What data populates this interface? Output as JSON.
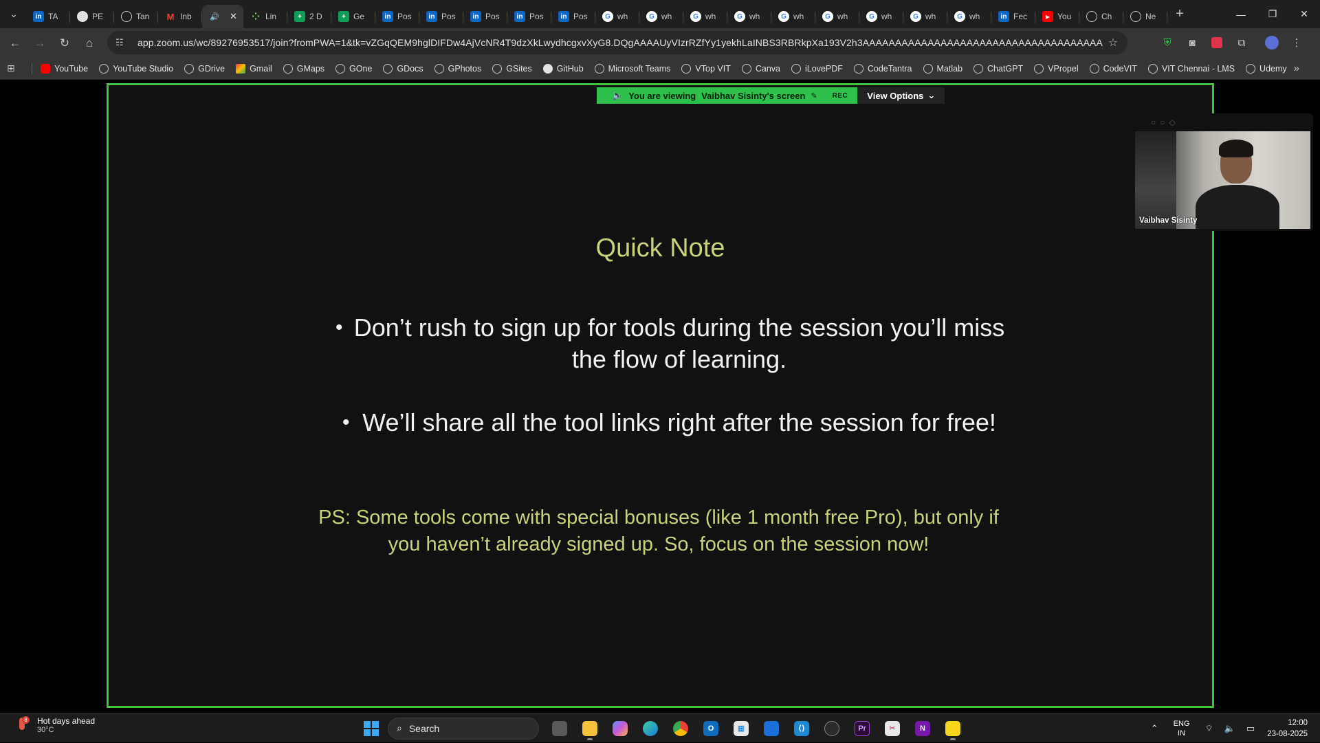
{
  "browser": {
    "tabs": [
      {
        "icon": "linkedin-icon",
        "label": "TA",
        "color": "#0a66c2"
      },
      {
        "icon": "github-icon",
        "label": "PE",
        "color": "#e3e3e3"
      },
      {
        "icon": "globe-icon",
        "label": "Tan",
        "color": "#c4c7c5"
      },
      {
        "icon": "gmail-icon",
        "label": "Inb",
        "color": "#ea4335"
      },
      {
        "icon": "speaker-icon",
        "label": "",
        "color": "#c4c7c5",
        "active": true
      },
      {
        "icon": "dots-icon",
        "label": "Lin",
        "color": "#7ed957"
      },
      {
        "icon": "sheets-icon",
        "label": "2 D",
        "color": "#0f9d58"
      },
      {
        "icon": "sheets-icon",
        "label": "Ge",
        "color": "#0f9d58"
      },
      {
        "icon": "linkedin-icon",
        "label": "Pos",
        "color": "#0a66c2"
      },
      {
        "icon": "linkedin-icon",
        "label": "Pos",
        "color": "#0a66c2"
      },
      {
        "icon": "linkedin-icon",
        "label": "Pos",
        "color": "#0a66c2"
      },
      {
        "icon": "linkedin-icon",
        "label": "Pos",
        "color": "#0a66c2"
      },
      {
        "icon": "linkedin-icon",
        "label": "Pos",
        "color": "#0a66c2"
      },
      {
        "icon": "google-icon",
        "label": "wh",
        "color": "#ffffff"
      },
      {
        "icon": "google-icon",
        "label": "wh",
        "color": "#ffffff"
      },
      {
        "icon": "google-icon",
        "label": "wh",
        "color": "#ffffff"
      },
      {
        "icon": "google-icon",
        "label": "wh",
        "color": "#ffffff"
      },
      {
        "icon": "google-icon",
        "label": "wh",
        "color": "#ffffff"
      },
      {
        "icon": "google-icon",
        "label": "wh",
        "color": "#ffffff"
      },
      {
        "icon": "google-icon",
        "label": "wh",
        "color": "#ffffff"
      },
      {
        "icon": "google-icon",
        "label": "wh",
        "color": "#ffffff"
      },
      {
        "icon": "google-icon",
        "label": "wh",
        "color": "#ffffff"
      },
      {
        "icon": "linkedin-icon",
        "label": "Fec",
        "color": "#0a66c2"
      },
      {
        "icon": "youtube-icon",
        "label": "You",
        "color": "#ff0000"
      },
      {
        "icon": "chatgpt-icon",
        "label": "Ch",
        "color": "#c4c7c5"
      },
      {
        "icon": "globe-icon",
        "label": "Ne",
        "color": "#c4c7c5"
      }
    ],
    "url": "app.zoom.us/wc/89276953517/join?fromPWA=1&tk=vZGqQEM9hglDIFDw4AjVcNR4T9dzXkLwydhcgxvXyG8.DQgAAAAUyVIzrRZfYy1yekhLaINBS3RBRkpXa193V2h3AAAAAAAAAAAAAAAAAAAAAAAAAAAAAAAAAAAAAAAAAAAA&_x_zm_r...",
    "bookmarks": [
      {
        "label": "YouTube",
        "icon": "yt"
      },
      {
        "label": "YouTube Studio",
        "icon": "globe"
      },
      {
        "label": "GDrive",
        "icon": "globe"
      },
      {
        "label": "Gmail",
        "icon": "gm"
      },
      {
        "label": "GMaps",
        "icon": "globe"
      },
      {
        "label": "GOne",
        "icon": "globe"
      },
      {
        "label": "GDocs",
        "icon": "globe"
      },
      {
        "label": "GPhotos",
        "icon": "globe"
      },
      {
        "label": "GSites",
        "icon": "globe"
      },
      {
        "label": "GitHub",
        "icon": "gh"
      },
      {
        "label": "Microsoft Teams",
        "icon": "globe"
      },
      {
        "label": "VTop VIT",
        "icon": "globe"
      },
      {
        "label": "Canva",
        "icon": "globe"
      },
      {
        "label": "iLovePDF",
        "icon": "globe"
      },
      {
        "label": "CodeTantra",
        "icon": "globe"
      },
      {
        "label": "Matlab",
        "icon": "globe"
      },
      {
        "label": "ChatGPT",
        "icon": "globe"
      },
      {
        "label": "VPropel",
        "icon": "globe"
      },
      {
        "label": "CodeVIT",
        "icon": "globe"
      },
      {
        "label": "VIT Chennai - LMS",
        "icon": "globe"
      },
      {
        "label": "Udemy",
        "icon": "globe"
      }
    ]
  },
  "zoom": {
    "banner": {
      "viewing_prefix": "You are viewing",
      "presenter_screen": "Vaibhav Sisinty's screen",
      "rec": "REC",
      "view_options": "View Options"
    },
    "slide": {
      "title": "Quick Note",
      "bullets": [
        "Don’t rush to sign up for tools during the session you’ll miss the flow of learning.",
        "We’ll share all the tool links right after the session for free!"
      ],
      "ps": "PS: Some tools come with special bonuses (like 1 month free Pro), but only if you haven’t already signed up. So, focus on the session now!"
    },
    "participant_name": "Vaibhav Sisinty"
  },
  "taskbar": {
    "weather_title": "Hot days ahead",
    "weather_temp": "30°C",
    "weather_badge": "8",
    "search_placeholder": "Search",
    "lang_top": "ENG",
    "lang_bottom": "IN",
    "time": "12:00",
    "date": "23-08-2025"
  },
  "colors": {
    "share_border": "#40c43a",
    "banner_green": "#2ec04a",
    "slide_accent": "#c9d27a"
  }
}
